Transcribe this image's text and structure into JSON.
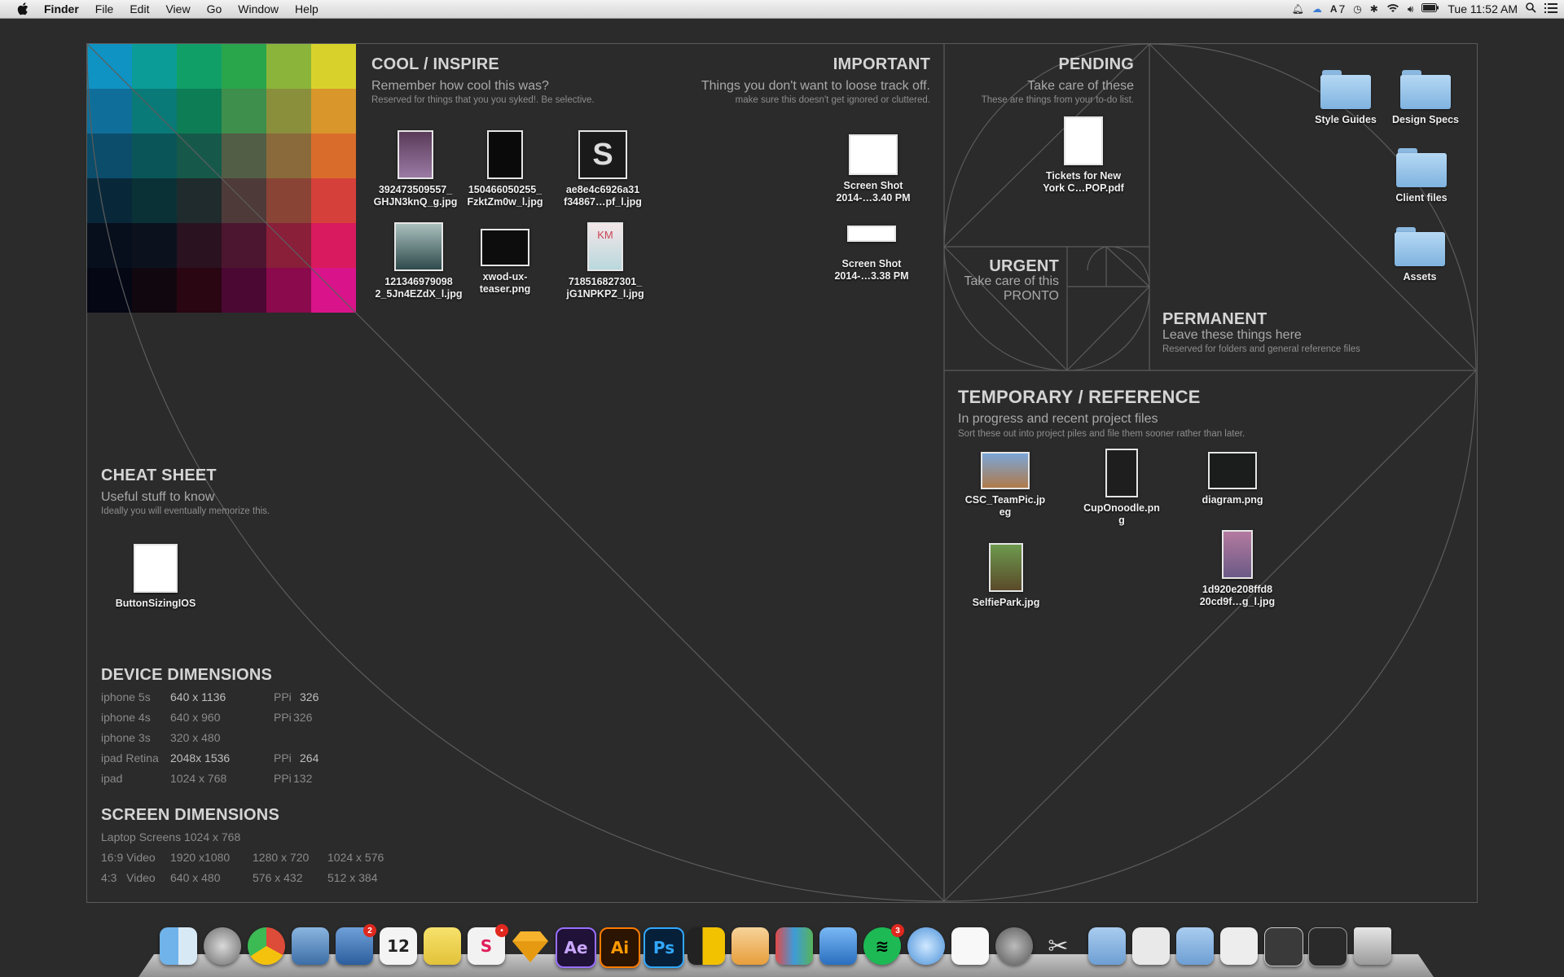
{
  "menubar": {
    "apple_icon": "apple-logo-icon",
    "app_name": "Finder",
    "menus": [
      "File",
      "Edit",
      "View",
      "Go",
      "Window",
      "Help"
    ],
    "status": {
      "adobe_count": "7",
      "clock": "Tue 11:52 AM"
    }
  },
  "sections": {
    "cool": {
      "title": "COOL / INSPIRE",
      "subtitle": "Remember how cool this was?",
      "note": "Reserved for things that you you syked!. Be selective."
    },
    "important": {
      "title": "IMPORTANT",
      "subtitle": "Things you don't want to loose track off.",
      "note": "make sure this doesn't get ignored or cluttered."
    },
    "pending": {
      "title": "PENDING",
      "subtitle": "Take care of these",
      "note": "These are things from your to-do list."
    },
    "urgent": {
      "title": "URGENT",
      "subtitle_line1": "Take care of this",
      "subtitle_line2": "PRONTO"
    },
    "permanent": {
      "title": "PERMANENT",
      "subtitle": "Leave these things here",
      "note": "Reserved for folders and general reference files"
    },
    "temporary": {
      "title": "TEMPORARY / REFERENCE",
      "subtitle": "In progress and recent project files",
      "note": "Sort these out into project piles and file them sooner rather than later."
    },
    "cheat": {
      "title": "CHEAT SHEET",
      "subtitle": "Useful stuff to know",
      "note": "Ideally you will eventually memorize this."
    },
    "device": {
      "title": "DEVICE DIMENSIONS"
    },
    "screen": {
      "title": "SCREEN DIMENSIONS"
    }
  },
  "files": {
    "cool": [
      "392473509557_\nGHJN3knQ_g.jpg",
      "150466050255_\nFzktZm0w_l.jpg",
      "ae8e4c6926a31\nf34867…pf_l.jpg",
      "121346979098\n2_5Jn4EZdX_l.jpg",
      "xwod-ux-\nteaser.png",
      "718516827301_\njG1NPKPZ_l.jpg"
    ],
    "important": [
      "Screen Shot\n2014-…3.40 PM",
      "Screen Shot\n2014-…3.38 PM"
    ],
    "pending": [
      "Tickets for New\nYork C…POP.pdf"
    ],
    "temporary": [
      "CSC_TeamPic.jp\neg",
      "CupOnoodle.pn\ng",
      "diagram.png",
      "SelfiePark.jpg",
      "1d920e208ffd8\n20cd9f…g_l.jpg"
    ],
    "cheat": [
      "ButtonSizingIOS"
    ]
  },
  "folders": [
    "Style Guides",
    "Design Specs",
    "Client files",
    "Assets"
  ],
  "device_dimensions": [
    {
      "device": "iphone 5s",
      "size": "640 x 1136",
      "ppi_label": "PPi",
      "ppi": "326"
    },
    {
      "device": "iphone 4s",
      "size": "640 x 960",
      "ppi_label": "PPi",
      "ppi": "326"
    },
    {
      "device": "iphone 3s",
      "size": "320 x 480",
      "ppi_label": "",
      "ppi": ""
    },
    {
      "device": "ipad Retina",
      "size": "2048x 1536",
      "ppi_label": "PPi",
      "ppi": "264"
    },
    {
      "device": "ipad",
      "size": "1024 x 768",
      "ppi_label": "PPi",
      "ppi": "132"
    }
  ],
  "screen_dimensions": {
    "laptop": "Laptop Screens 1024 x 768",
    "rows": [
      {
        "label": "16:9 Video",
        "a": "1920 x1080",
        "b": "1280 x 720",
        "c": "1024 x 576"
      },
      {
        "label": "4:3   Video",
        "a": "640 x 480",
        "b": "576 x 432",
        "c": "512 x 384"
      }
    ]
  },
  "palette": [
    "#0f93c3",
    "#0b9c98",
    "#109f67",
    "#29a54c",
    "#8bb53a",
    "#d9d12b",
    "#106f9a",
    "#0a7a78",
    "#0d7d55",
    "#3e8e4c",
    "#8a8f3c",
    "#d9962a",
    "#0b4d6a",
    "#0a5558",
    "#16594a",
    "#525e45",
    "#8a6a3b",
    "#da6c2b",
    "#08283a",
    "#0a3136",
    "#1f2b2c",
    "#4f3a3a",
    "#8a4436",
    "#d5413a",
    "#070f1d",
    "#0c121d",
    "#2a1221",
    "#4d1630",
    "#8a1f3a",
    "#d91a5e",
    "#050714",
    "#10070f",
    "#2a0512",
    "#4a0832",
    "#8a0a4d",
    "#d9148a"
  ],
  "dock": [
    "finder-icon",
    "launchpad-icon",
    "chrome-icon",
    "preview-icon",
    "mail-icon",
    "calendar-icon",
    "notes-icon",
    "slack-icon",
    "sketch-icon",
    "after-effects-icon",
    "illustrator-icon",
    "photoshop-icon",
    "files-icon",
    "pages-icon",
    "keynote-chart-icon",
    "keynote-icon",
    "spotify-icon",
    "messages-icon",
    "textedit-icon",
    "system-preferences-icon",
    "utilities-icon",
    "downloads-stack-icon",
    "documents-stack-icon",
    "applications-stack-icon",
    "screenshot-stack-icon",
    "window-stack-icon",
    "window-stack-2-icon",
    "trash-icon"
  ],
  "dock_labels": {
    "calendar": "12",
    "after_effects": "Ae",
    "illustrator": "Ai",
    "photoshop": "Ps",
    "mail_badge": "2",
    "slack_badge": "•",
    "spotify_badge": "3"
  },
  "colors": {
    "desktop": "#2b2b2b",
    "line": "#5a5a5a",
    "folder": "#9ecbef"
  }
}
